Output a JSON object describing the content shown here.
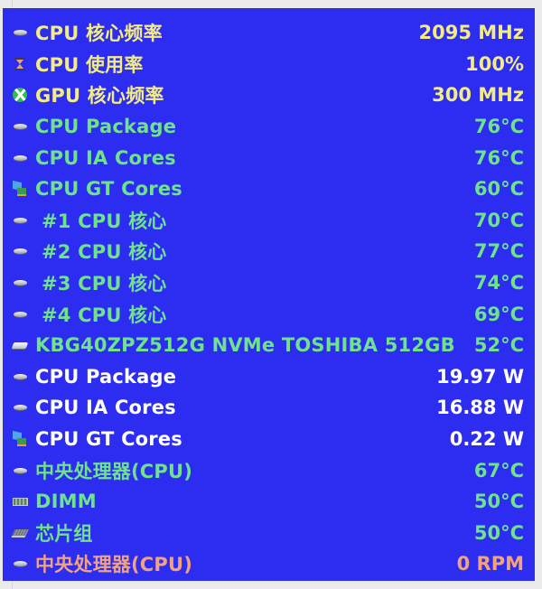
{
  "colors": {
    "panel_background": "#2d2df2",
    "yellow": "#f3ec84",
    "green": "#6fe28c",
    "white": "#ffffff",
    "salmon": "#f3a27e"
  },
  "sensors": [
    {
      "icon": "cpu-chip-icon",
      "label": "CPU 核心频率",
      "value": "2095 MHz",
      "color": "yellow"
    },
    {
      "icon": "hourglass-icon",
      "label": "CPU 使用率",
      "value": "100%",
      "color": "yellow"
    },
    {
      "icon": "xbox-gpu-icon",
      "label": "GPU 核心频率",
      "value": "300 MHz",
      "color": "yellow"
    },
    {
      "icon": "cpu-chip-icon",
      "label": "CPU Package",
      "value": "76°C",
      "color": "green"
    },
    {
      "icon": "cpu-chip-icon",
      "label": "CPU IA Cores",
      "value": "76°C",
      "color": "green"
    },
    {
      "icon": "graphics-card-icon",
      "label": "CPU GT Cores",
      "value": "60°C",
      "color": "green"
    },
    {
      "icon": "cpu-chip-icon",
      "label": "#1 CPU 核心",
      "value": "70°C",
      "color": "green"
    },
    {
      "icon": "cpu-chip-icon",
      "label": "#2 CPU 核心",
      "value": "77°C",
      "color": "green"
    },
    {
      "icon": "cpu-chip-icon",
      "label": "#3 CPU 核心",
      "value": "74°C",
      "color": "green"
    },
    {
      "icon": "cpu-chip-icon",
      "label": "#4 CPU 核心",
      "value": "69°C",
      "color": "green"
    },
    {
      "icon": "drive-icon",
      "label": "KBG40ZPZ512G NVMe TOSHIBA 512GB",
      "value": "52°C",
      "color": "green"
    },
    {
      "icon": "cpu-chip-icon",
      "label": "CPU Package",
      "value": "19.97 W",
      "color": "white"
    },
    {
      "icon": "cpu-chip-icon",
      "label": "CPU IA Cores",
      "value": "16.88 W",
      "color": "white"
    },
    {
      "icon": "graphics-card-icon",
      "label": "CPU GT Cores",
      "value": "0.22 W",
      "color": "white"
    },
    {
      "icon": "cpu-chip-icon",
      "label": "中央处理器(CPU)",
      "value": "67°C",
      "color": "green"
    },
    {
      "icon": "memory-dimm-icon",
      "label": "DIMM",
      "value": "50°C",
      "color": "green"
    },
    {
      "icon": "chipset-icon",
      "label": "芯片组",
      "value": "50°C",
      "color": "green"
    },
    {
      "icon": "cpu-chip-icon",
      "label": "中央处理器(CPU)",
      "value": "0 RPM",
      "color": "salmon"
    }
  ]
}
